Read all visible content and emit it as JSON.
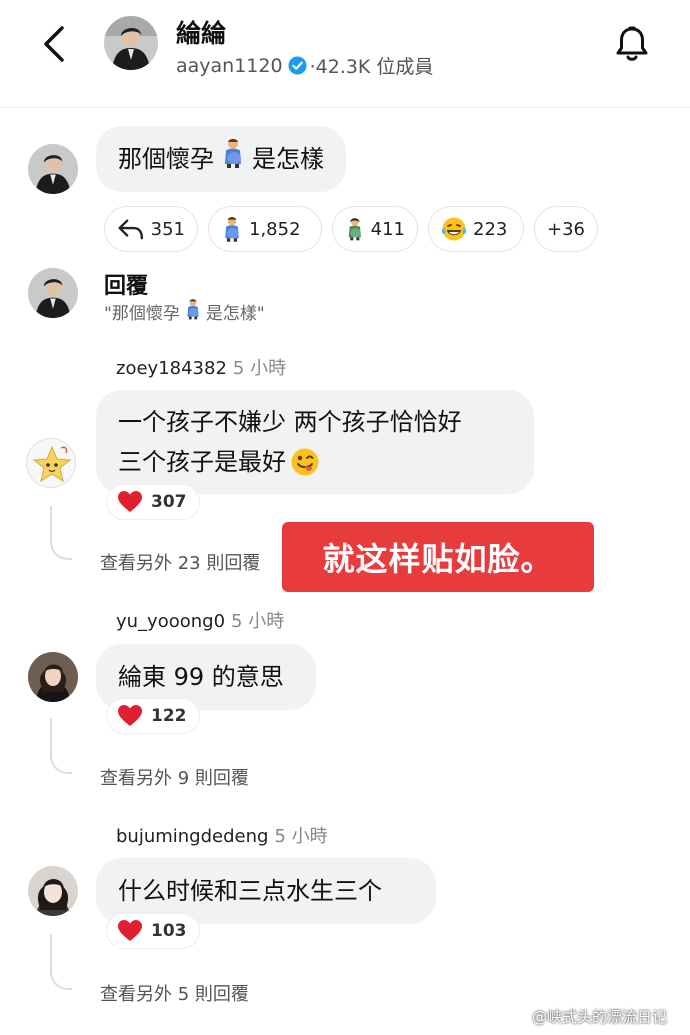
{
  "header": {
    "channel_name": "綸綸",
    "handle": "aayan1120",
    "members": "·42.3K 位成員"
  },
  "post": {
    "text_before": "那個懷孕",
    "text_after": "是怎樣",
    "reactions": [
      {
        "icon": "reply-arrow-icon",
        "count": "351"
      },
      {
        "icon": "pregnant-man-emoji",
        "count": "1,852"
      },
      {
        "icon": "pregnant-person-emoji",
        "count": "411"
      },
      {
        "icon": "laughing-tears-emoji",
        "count": "223"
      },
      {
        "icon": "none",
        "count": "+36"
      }
    ]
  },
  "reply_header": {
    "title": "回覆",
    "quote_before": "\"那個懷孕",
    "quote_after": "是怎樣\""
  },
  "comments": [
    {
      "username": "zoey184382",
      "time": "5 小時",
      "line1": "一个孩子不嫌少 两个孩子恰恰好",
      "line2": "三个孩子是最好",
      "likes": "307",
      "more": "查看另外 23 則回覆"
    },
    {
      "username": "yu_yooong0",
      "time": "5 小時",
      "line1": "綸東 99 的意思",
      "likes": "122",
      "more": "查看另外 9 則回覆"
    },
    {
      "username": "bujumingdedeng",
      "time": "5 小時",
      "line1": "什么时候和三点水生三个",
      "likes": "103",
      "more": "查看另外 5 則回覆"
    }
  ],
  "overlay_text": "就这样贴如脸。",
  "watermark": "@峡式头的漂流日记",
  "colors": {
    "accent_verified": "#1d9bf0",
    "overlay": "#e83b3e",
    "heart": "#e0202f"
  }
}
